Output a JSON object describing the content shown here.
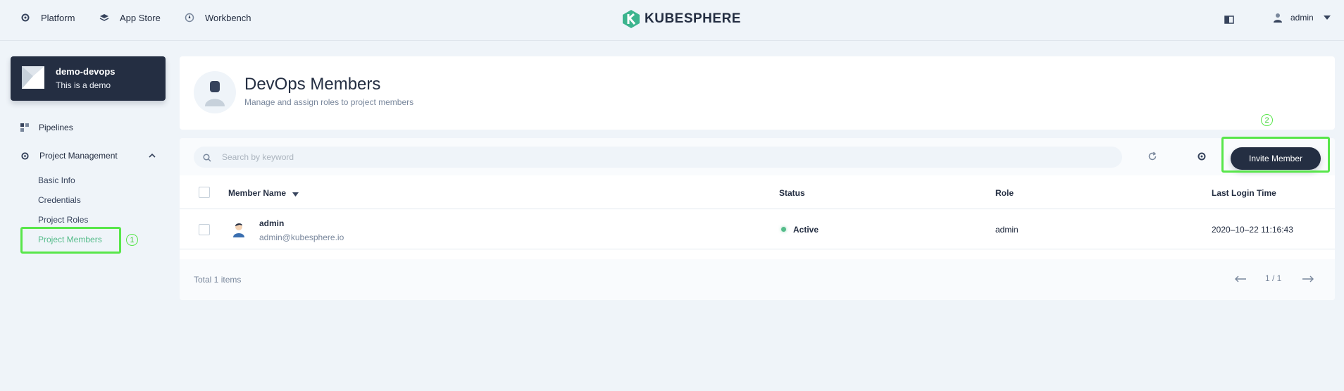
{
  "topnav": {
    "platform": "Platform",
    "app_store": "App Store",
    "workbench": "Workbench",
    "logo_text": "KUBESPHERE",
    "user": "admin"
  },
  "workspace": {
    "name": "demo-devops",
    "description": "This is a demo"
  },
  "sidebar": {
    "pipelines": "Pipelines",
    "project_management": "Project Management",
    "sub_items": [
      "Basic Info",
      "Credentials",
      "Project Roles",
      "Project Members"
    ],
    "active_item": "Project Members"
  },
  "header": {
    "title": "DevOps Members",
    "description": "Manage and assign roles to project members"
  },
  "toolbar": {
    "search_placeholder": "Search by keyword",
    "invite_label": "Invite Member"
  },
  "table": {
    "columns": [
      "Member Name",
      "Status",
      "Role",
      "Last Login Time"
    ],
    "rows": [
      {
        "name": "admin",
        "email": "admin@kubesphere.io",
        "status": "Active",
        "role": "admin",
        "last_login": "2020–10–22 11:16:43"
      }
    ]
  },
  "footer": {
    "total": "Total 1 items",
    "page": "1 / 1"
  },
  "annotations": [
    "1",
    "2"
  ],
  "colors": {
    "accent_green": "#55bc8a",
    "highlight": "#58e64a",
    "dark": "#242e42",
    "background": "#eff4f9"
  },
  "icons": [
    "gear-icon",
    "layers-icon",
    "compass-icon",
    "kubesphere-logo",
    "notebook-icon",
    "user-icon",
    "caret-down-icon",
    "grid-icon",
    "chevron-up-icon",
    "search-icon",
    "refresh-icon",
    "arrow-left-icon",
    "arrow-right-icon"
  ]
}
